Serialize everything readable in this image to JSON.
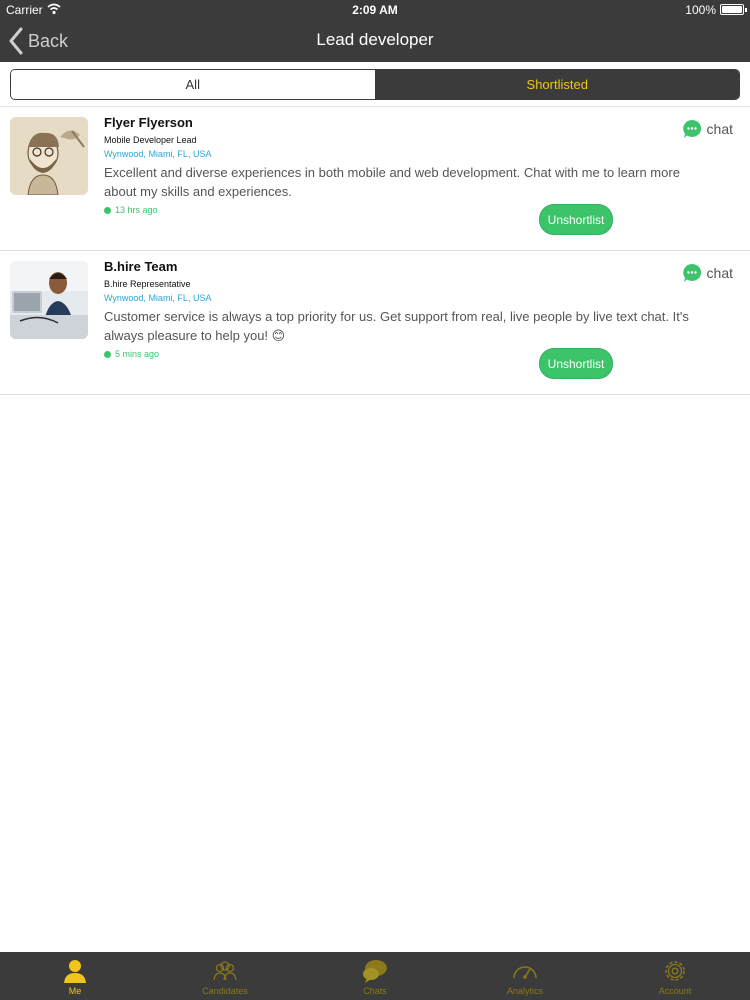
{
  "status_bar": {
    "carrier": "Carrier",
    "time": "2:09 AM",
    "battery": "100%"
  },
  "nav": {
    "back_label": "Back",
    "title": "Lead developer"
  },
  "segments": {
    "all": "All",
    "shortlisted": "Shortlisted",
    "selected": "Shortlisted"
  },
  "items": [
    {
      "name": "Flyer Flyerson",
      "role": "Mobile Developer Lead",
      "location": "Wynwood, Miami, FL, USA",
      "bio": "Excellent and diverse experiences in both mobile and web development. Chat with me to learn more about my skills and experiences.",
      "time": "13 hrs ago",
      "chat_label": "chat",
      "action_label": "Unshortlist"
    },
    {
      "name": "B.hire Team",
      "role": "B.hire Representative",
      "location": "Wynwood, Miami, FL, USA",
      "bio": "Customer service is always a top priority for us. Get support from real, live people by live text chat. It's always pleasure to help you! 😊",
      "time": "5 mins ago",
      "chat_label": "chat",
      "action_label": "Unshortlist"
    }
  ],
  "tabs": [
    {
      "label": "Me",
      "icon": "person-icon",
      "active": true
    },
    {
      "label": "Candidates",
      "icon": "group-icon",
      "active": false
    },
    {
      "label": "Chats",
      "icon": "chat-bubbles-icon",
      "active": false
    },
    {
      "label": "Analytics",
      "icon": "gauge-icon",
      "active": false
    },
    {
      "label": "Account",
      "icon": "gear-icon",
      "active": false
    }
  ],
  "colors": {
    "header_bg": "#3b3b3b",
    "accent_yellow": "#f0c419",
    "accent_green": "#3cc46b",
    "location_blue": "#2aa6d8"
  }
}
